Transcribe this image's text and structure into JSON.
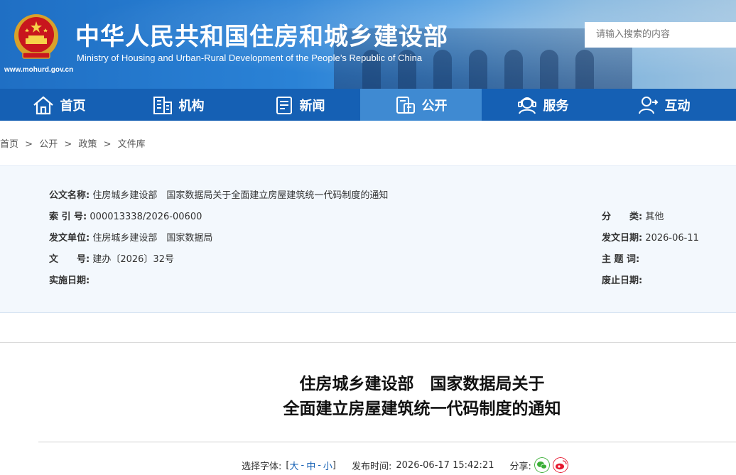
{
  "header": {
    "title": "中华人民共和国住房和城乡建设部",
    "subtitle": "Ministry of Housing and Urban-Rural Development of the People’s Republic of China",
    "url": "www.mohurd.gov.cn",
    "search_placeholder": "请输入搜索的内容"
  },
  "nav": {
    "items": [
      {
        "label": "首页",
        "icon": "home-icon"
      },
      {
        "label": "机构",
        "icon": "building-icon"
      },
      {
        "label": "新闻",
        "icon": "news-icon"
      },
      {
        "label": "公开",
        "icon": "disclosure-icon",
        "active": true
      },
      {
        "label": "服务",
        "icon": "service-icon"
      },
      {
        "label": "互动",
        "icon": "interaction-icon"
      }
    ]
  },
  "breadcrumb": [
    "首页",
    "公开",
    "政策",
    "文件库"
  ],
  "breadcrumb_sep": ">",
  "meta": {
    "doc_name_label": "公文名称:",
    "doc_name": "住房城乡建设部　国家数据局关于全面建立房屋建筑统一代码制度的通知",
    "index_label": "索 引 号:",
    "index": "000013338/2026-00600",
    "category_label": "分　　类:",
    "category": "其他",
    "issuer_label": "发文单位:",
    "issuer": "住房城乡建设部　国家数据局",
    "issue_date_label": "发文日期:",
    "issue_date": "2026-06-11",
    "doc_no_label": "文　　号:",
    "doc_no": "建办〔2026〕32号",
    "keywords_label": "主 题 词:",
    "keywords": "",
    "effective_label": "实施日期:",
    "effective": "",
    "expire_label": "废止日期:",
    "expire": ""
  },
  "document": {
    "title_line1": "住房城乡建设部　国家数据局关于",
    "title_line2": "全面建立房屋建筑统一代码制度的通知"
  },
  "tools": {
    "font_label": "选择字体:",
    "bracket_open": "[",
    "size_large": "大",
    "sep1": "-",
    "size_medium": "中",
    "sep2": "-",
    "size_small": "小",
    "bracket_close": "]",
    "publish_label": "发布时间:",
    "publish_time": "2026-06-17 15:42:21",
    "share_label": "分享:"
  },
  "colors": {
    "nav_bg": "#1560b4",
    "nav_active": "#3f8ad2",
    "meta_bg": "#f3f8fd",
    "wechat": "#3aae36",
    "weibo": "#e6162d"
  }
}
